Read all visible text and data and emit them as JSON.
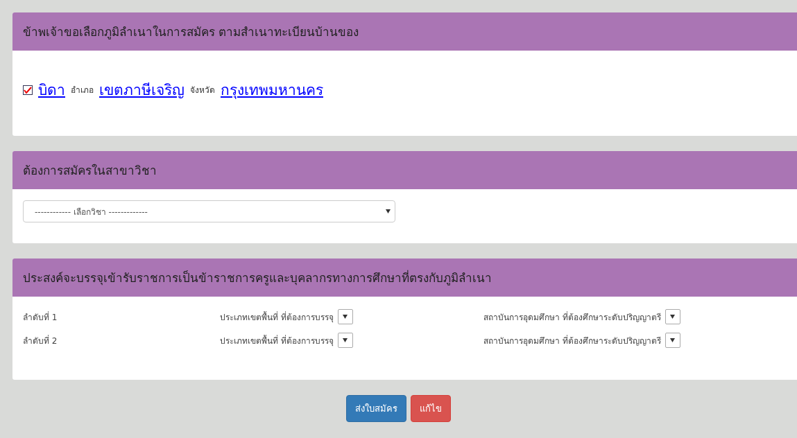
{
  "panels": [
    {
      "kind": "domicile",
      "title": "ข้าพเจ้าขอเลือกภูมิลำเนาในการสมัคร ตามสำเนาทะเบียนบ้านของ",
      "checked": true,
      "owner": "บิดา",
      "district_label": "อำเภอ",
      "district": "เขตภาษีเจริญ",
      "province_label": "จังหวัด",
      "province": "กรุงเทพมหานคร"
    },
    {
      "kind": "subject",
      "title": "ต้องการสมัครในสาขาวิชา",
      "placeholder": "------------ เลือกวิชา -------------"
    },
    {
      "kind": "ranks",
      "title": "ประสงค์จะบรรจุเข้ารับราชการเป็นข้าราชการครูและบุคลากรทางการศึกษาที่ตรงกับภูมิลำเนา",
      "rows": [
        {
          "rank": "ลำดับที่ 1",
          "area_label": "ประเภทเขตพื้นที่  ที่ต้องการบรรจุ",
          "institute_label": "สถาบันการอุดมศึกษา  ที่ต้องศึกษาระดับปริญญาตรี"
        },
        {
          "rank": "ลำดับที่ 2",
          "area_label": "ประเภทเขตพื้นที่  ที่ต้องการบรรจุ",
          "institute_label": "สถาบันการอุดมศึกษา  ที่ต้องศึกษาระดับปริญญาตรี"
        }
      ]
    }
  ],
  "buttons": [
    {
      "kind": "primary",
      "label": "ส่งใบสมัคร"
    },
    {
      "kind": "danger",
      "label": "แก้ไข"
    }
  ]
}
